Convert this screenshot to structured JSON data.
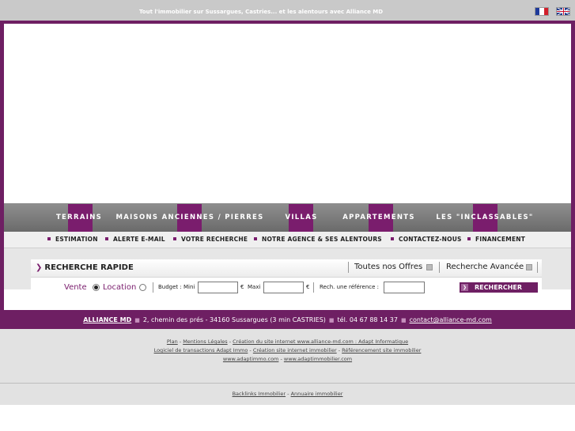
{
  "header": {
    "tagline": "Tout l'immobilier sur Sussargues, Castries... et les alentours avec Alliance MD",
    "flags": [
      "france-flag-icon",
      "uk-flag-icon"
    ]
  },
  "nav": {
    "items": [
      "TERRAINS",
      "MAISONS ANCIENNES / PIERRES",
      "VILLAS",
      "APPARTEMENTS",
      "LES \"INCLASSABLES\""
    ]
  },
  "subnav": {
    "items": [
      "ESTIMATION",
      "ALERTE E-MAIL",
      "VOTRE RECHERCHE",
      "NOTRE AGENCE  & SES ALENTOURS",
      "CONTACTEZ-NOUS",
      "FINANCEMENT"
    ]
  },
  "search": {
    "title": "RECHERCHE RAPIDE",
    "all_offers": "Toutes nos Offres",
    "advanced": "Recherche Avancée",
    "vente": "Vente",
    "location": "Location",
    "budget_label": "Budget : Mini",
    "euro1": "€",
    "maxi": "Maxi",
    "euro2": "€",
    "ref_label": "Rech. une référence :",
    "button": "RECHERCHER"
  },
  "address": {
    "name": "ALLIANCE MD",
    "street": "2, chemin des prés - 34160 Sussargues (3 min CASTRIES)",
    "phone": "tél. 04 67 88 14 37",
    "email": "contact@alliance-md.com"
  },
  "footer": {
    "plan": "Plan",
    "mentions": "Mentions Légales",
    "creation": "Création du site internet www.alliance-md.com : Adapt Informatique",
    "logiciel": "Logiciel de transactions Adapt Immo",
    "creation_immo": "Création site internet immobilier",
    "referencement": "Référencement site immobilier",
    "site1": "www.adaptimmo.com",
    "site2": "www.adaptimmobilier.com",
    "backlinks": "Backlinks Immobilier",
    "annuaire": "Annuaire immobilier"
  },
  "colors": {
    "brand": "#6e1f63",
    "nav_gray": "#7a7a7a"
  }
}
